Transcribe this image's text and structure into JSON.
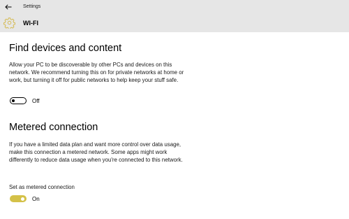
{
  "window": {
    "title": "Settings"
  },
  "header": {
    "title": "WI-FI",
    "icon": "gear-icon",
    "icon_color": "#d4b84a"
  },
  "find_devices": {
    "heading": "Find devices and content",
    "description": "Allow your PC to be discoverable by other PCs and devices on this network. We recommend turning this on for private networks at home or work, but turning it off for public networks to help keep your stuff safe.",
    "toggle_state": "Off"
  },
  "metered": {
    "heading": "Metered connection",
    "description": "If you have a limited data plan and want more control over data usage, make this connection a metered network. Some apps might work differently to reduce data usage when you're connected to this network.",
    "toggle_caption": "Set as metered connection",
    "toggle_state": "On",
    "accent_color": "#d4c148"
  }
}
